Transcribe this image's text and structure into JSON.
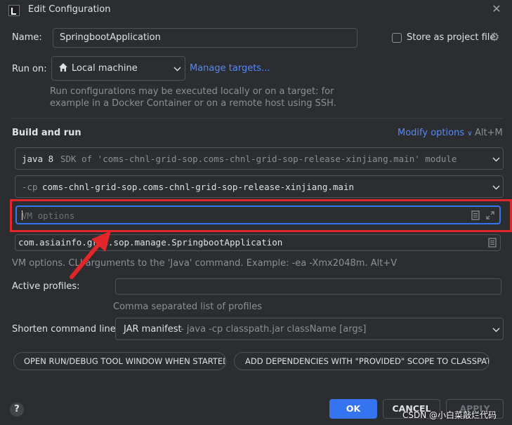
{
  "window": {
    "title": "Edit Configuration",
    "close_icon": "close-icon"
  },
  "name": {
    "label": "Name:",
    "value": "SpringbootApplication"
  },
  "store_project_file": {
    "label": "Store as project file",
    "checked": false
  },
  "run_on": {
    "label": "Run on:",
    "selected": "Local machine",
    "manage_link": "Manage targets...",
    "hint_line1": "Run configurations may be executed locally or on a target: for",
    "hint_line2": "example in a Docker Container or on a remote host using SSH."
  },
  "build_and_run": {
    "heading": "Build and run",
    "modify_options": "Modify options",
    "modify_chevron": "∨",
    "modify_shortcut": "Alt+M",
    "jdk_version": "java 8",
    "jdk_detail": "SDK of 'coms-chnl-grid-sop.coms-chnl-grid-sop-release-xinjiang.main' module",
    "cp_flag": "-cp",
    "cp_value": "coms-chnl-grid-sop.coms-chnl-grid-sop-release-xinjiang.main",
    "vm_placeholder": "VM options",
    "main_class": "com.asiainfo.grid.sop.manage.SpringbootApplication",
    "hint": "VM options. CLI arguments to the 'Java' command. Example: -ea -Xmx2048m. Alt+V"
  },
  "active_profiles": {
    "label": "Active profiles:",
    "value": "",
    "hint": "Comma separated list of profiles"
  },
  "shorten": {
    "label": "Shorten command line:",
    "value": "JAR manifest",
    "detail": "- java -cp classpath.jar className [args]"
  },
  "tags": [
    {
      "label": "OPEN RUN/DEBUG TOOL WINDOW WHEN STARTED"
    },
    {
      "label": "ADD DEPENDENCIES WITH \"PROVIDED\" SCOPE TO CLASSPATH"
    }
  ],
  "buttons": {
    "ok": "OK",
    "cancel": "CANCEL",
    "apply": "APPLY",
    "help": "?"
  },
  "watermark": "CSDN @小白菜敲烂代码",
  "colors": {
    "accent": "#3574f0",
    "link": "#548af7",
    "highlight": "#e3262a",
    "background": "#2b2d30"
  }
}
